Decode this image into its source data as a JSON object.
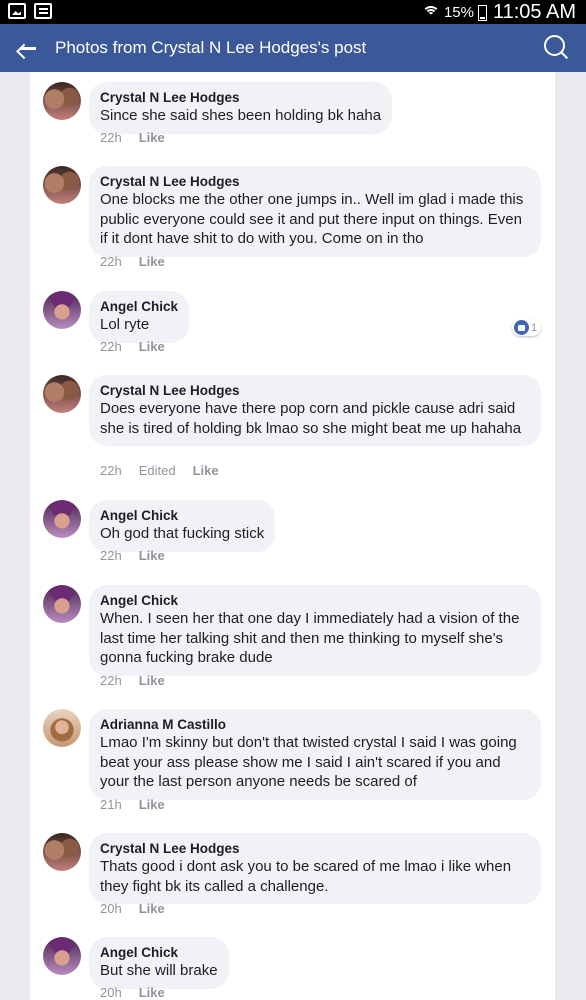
{
  "status_bar": {
    "battery": "15%",
    "time": "11:05 AM",
    "icons": [
      "gallery-icon",
      "message-icon",
      "wifi-icon",
      "battery-icon"
    ]
  },
  "header": {
    "title": "Photos from Crystal N Lee Hodges's post",
    "background_color": "#3b5998"
  },
  "comments": [
    {
      "author": "Crystal N Lee Hodges",
      "text": "Since she said shes been holding bk haha",
      "time": "22h",
      "edited": "",
      "like_label": "Like"
    },
    {
      "author": "Crystal N Lee Hodges",
      "text": "One blocks me the other one jumps in.. Well im glad i made this public everyone could see it and put there input on things. Even if it dont have shit to do with you. Come on in tho",
      "time": "22h",
      "edited": "",
      "like_label": "Like",
      "reaction_count": "1"
    },
    {
      "author": "Angel Chick",
      "text": "Lol ryte",
      "time": "22h",
      "edited": "",
      "like_label": "Like"
    },
    {
      "author": "Crystal N Lee Hodges",
      "text": "Does everyone have there pop corn and pickle cause adri said she is tired of holding bk lmao so she might beat me up hahaha",
      "time": "22h",
      "edited": "Edited",
      "like_label": "Like"
    },
    {
      "author": "Angel Chick",
      "text": "Oh god that fucking  stick",
      "time": "22h",
      "edited": "",
      "like_label": "Like"
    },
    {
      "author": "Angel Chick",
      "text": "When. I seen her that one day I immediately  had a vision of the last time her talking shit  and then me thinking to myself she's gonna fucking brake dude",
      "time": "22h",
      "edited": "",
      "like_label": "Like"
    },
    {
      "author": "Adrianna M Castillo",
      "text": "Lmao I'm skinny but don't that twisted crystal I said I was going beat your ass please show me I said I ain't scared if you and your the last person anyone needs be scared of",
      "time": "21h",
      "edited": "",
      "like_label": "Like"
    },
    {
      "author": "Crystal N Lee Hodges",
      "text": "Thats good i dont ask you to be scared of me lmao i like when they fight bk its called a challenge.",
      "time": "20h",
      "edited": "",
      "like_label": "Like"
    },
    {
      "author": "Angel Chick",
      "text": "But she will brake",
      "time": "20h",
      "edited": "",
      "like_label": "Like"
    }
  ]
}
